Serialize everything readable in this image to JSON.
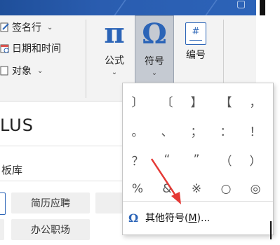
{
  "ribbon": {
    "small_buttons": [
      {
        "label": "签名行",
        "icon": "signature-icon",
        "has_dropdown": true
      },
      {
        "label": "日期和时间",
        "icon": "calendar-icon",
        "has_dropdown": false
      },
      {
        "label": "对象",
        "icon": "object-icon",
        "has_dropdown": true
      }
    ],
    "formula": {
      "glyph": "π",
      "label": "公式",
      "arrow": "⌄"
    },
    "symbol": {
      "glyph": "Ω",
      "label": "符号",
      "arrow": "⌄"
    },
    "numbering": {
      "glyph": "#",
      "label": "编号"
    }
  },
  "panel": {
    "title": "LUS",
    "subtitle": "板库",
    "tags": [
      "简历应聘",
      "办公职场"
    ]
  },
  "symbol_menu": {
    "symbols": [
      "〕",
      "〔",
      "】",
      "【",
      "，",
      "。",
      "、",
      "；",
      "：",
      "！",
      "？",
      "“",
      "”",
      "（",
      "）",
      "%",
      "&",
      "※",
      "○",
      "◎"
    ],
    "more_symbols_icon": "Ω",
    "more_symbols_label_prefix": "其他符号(",
    "more_symbols_accel": "M",
    "more_symbols_label_suffix": ")..."
  },
  "colors": {
    "accent": "#2b64b7",
    "titlebar": "#2a5db0",
    "annotation_arrow": "#e53935"
  }
}
